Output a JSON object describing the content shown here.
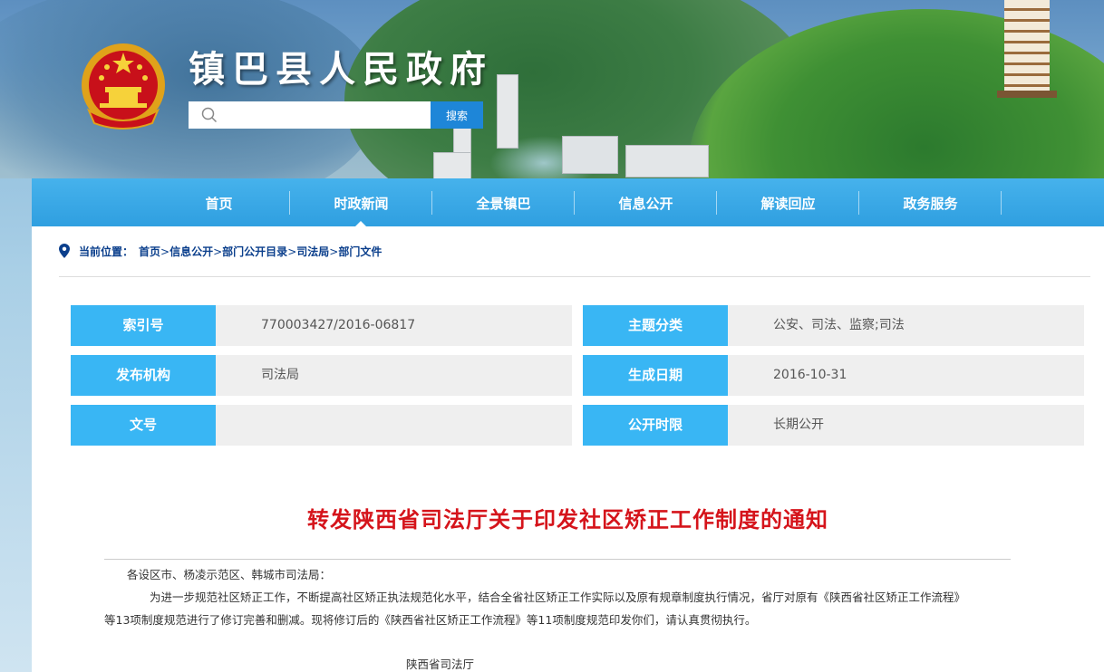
{
  "header": {
    "site_title": "镇巴县人民政府",
    "search": {
      "placeholder": "",
      "button_label": "搜索"
    }
  },
  "nav": {
    "items": [
      {
        "label": "首页"
      },
      {
        "label": "时政新闻"
      },
      {
        "label": "全景镇巴"
      },
      {
        "label": "信息公开"
      },
      {
        "label": "解读回应"
      },
      {
        "label": "政务服务"
      }
    ],
    "active_index": 1
  },
  "breadcrumb": {
    "label": "当前位置：",
    "items": [
      "首页",
      "信息公开",
      "部门公开目录",
      "司法局",
      "部门文件"
    ],
    "separator": ">"
  },
  "meta": {
    "index_label": "索引号",
    "index_value": "770003427/2016-06817",
    "topic_label": "主题分类",
    "topic_value": "公安、司法、监察;司法",
    "publisher_label": "发布机构",
    "publisher_value": "司法局",
    "date_label": "生成日期",
    "date_value": "2016-10-31",
    "docno_label": "文号",
    "docno_value": "",
    "period_label": "公开时限",
    "period_value": "长期公开"
  },
  "document": {
    "title": "转发陕西省司法厅关于印发社区矫正工作制度的通知",
    "salutation": "各设区市、杨凌示范区、韩城市司法局：",
    "para1_line1": "为进一步规范社区矫正工作，不断提高社区矫正执法规范化水平，结合全省社区矫正工作实际以及原有规章制度执行情况，省厅对原有《陕西省社区矫正工作流程》",
    "para1_line2": "等13项制度规范进行了修订完善和删减。现将修订后的《陕西省社区矫正工作流程》等11项制度规范印发你们，请认真贯彻执行。",
    "signature": "陕西省司法厅"
  },
  "colors": {
    "nav_bg": "#2f9fe0",
    "meta_label_bg": "#39b6f4",
    "title_red": "#d5141b",
    "breadcrumb_blue": "#0b3f8c"
  }
}
